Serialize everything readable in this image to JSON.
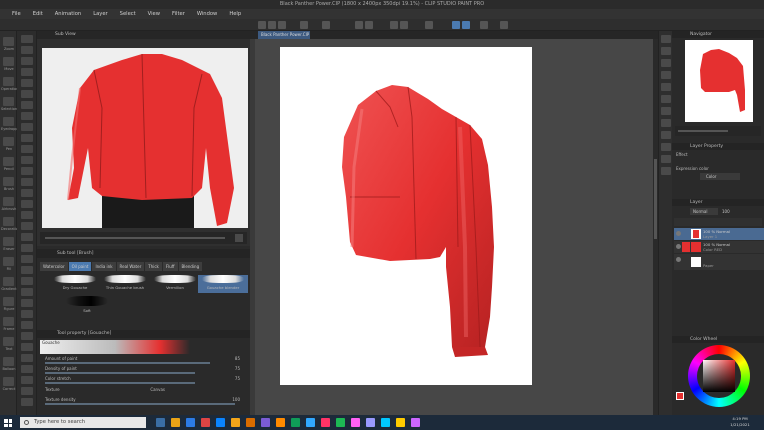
{
  "window": {
    "title": "Black Panther Power.CIP (1800 x 2400px 350dpi 19.1%) - CLIP STUDIO PAINT PRO"
  },
  "menu": [
    "File",
    "Edit",
    "Animation",
    "Layer",
    "Select",
    "View",
    "Filter",
    "Window",
    "Help"
  ],
  "left_tools": {
    "labels": [
      "Zoom",
      "Move",
      "Operation",
      "Selection",
      "Eyedropper",
      "Pen",
      "Pencil",
      "Brush",
      "Airbrush",
      "Decoration",
      "Eraser",
      "Fill",
      "Gradient",
      "Figure",
      "Frame",
      "Text",
      "Balloon",
      "Correct"
    ]
  },
  "reference_panel": {
    "title": "Sub View"
  },
  "brush_panel": {
    "title": "Sub tool [Brush]",
    "tabs": [
      "Watercolor",
      "Oil paint",
      "India ink",
      "Real Water",
      "Thick",
      "Fluff",
      "Blending"
    ],
    "brushes": [
      {
        "name": "Dry Gouache",
        "selected": false
      },
      {
        "name": "Thin Gouache brush",
        "selected": false
      },
      {
        "name": "Vermilion",
        "selected": false
      },
      {
        "name": "Gouache blender",
        "selected": true
      },
      {
        "name": "Soft",
        "selected": false
      }
    ]
  },
  "tool_property": {
    "title": "Tool property [Gouache]",
    "brush_name": "Gouache",
    "rows": [
      {
        "label": "Amount of paint",
        "value": "85"
      },
      {
        "label": "Density of paint",
        "value": "75"
      },
      {
        "label": "Color stretch",
        "value": "75"
      },
      {
        "label": "Texture",
        "value": "Canvas"
      },
      {
        "label": "Texture density",
        "value": "100"
      }
    ]
  },
  "canvas": {
    "tab_label": "Black Panther Power.CIP"
  },
  "navigator": {
    "title": "Navigator"
  },
  "layer_property": {
    "title": "Layer Property",
    "effect_label": "Effect",
    "expression_color_label": "Expression color",
    "expression_color_value": "Color"
  },
  "layers": {
    "title": "Layer",
    "blend_mode": "Normal",
    "opacity": "100",
    "items": [
      {
        "percent": "100 % Normal",
        "name": "Layer 1",
        "selected": true
      },
      {
        "percent": "100 % Normal",
        "name": "Color RED",
        "selected": false
      },
      {
        "percent": "",
        "name": "Paper",
        "selected": false
      }
    ]
  },
  "color_wheel": {
    "title": "Color Wheel",
    "current_color": "#e53030"
  },
  "taskbar": {
    "search_placeholder": "Type here to search",
    "time": "4:19 PM",
    "date": "1/21/2021"
  },
  "colors": {
    "jacket_red": "#e53030",
    "selection_blue": "#4a6a92",
    "panel_bg": "#2a2a2a"
  }
}
